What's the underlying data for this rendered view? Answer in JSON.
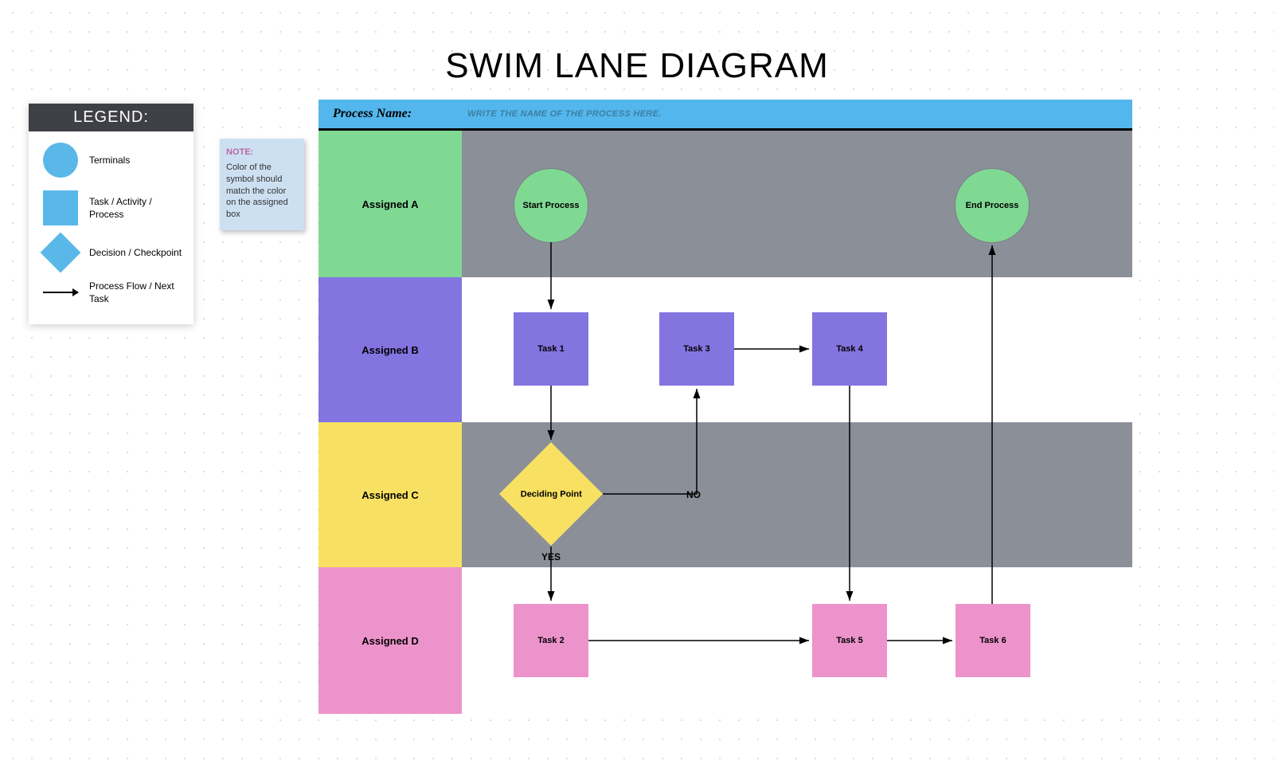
{
  "title": "SWIM LANE DIAGRAM",
  "legend": {
    "header": "LEGEND:",
    "items": [
      {
        "label": "Terminals"
      },
      {
        "label": "Task / Activity / Process"
      },
      {
        "label": "Decision / Checkpoint"
      },
      {
        "label": "Process Flow / Next Task"
      }
    ]
  },
  "note": {
    "title": "NOTE:",
    "text": "Color of the symbol should match the color on the assigned box"
  },
  "process_bar": {
    "label": "Process Name:",
    "placeholder": "WRITE THE NAME OF THE PROCESS HERE."
  },
  "lanes": [
    {
      "label": "Assigned A"
    },
    {
      "label": "Assigned B"
    },
    {
      "label": "Assigned C"
    },
    {
      "label": "Assigned D"
    }
  ],
  "nodes": {
    "start": "Start Process",
    "end": "End Process",
    "task1": "Task 1",
    "task2": "Task 2",
    "task3": "Task 3",
    "task4": "Task 4",
    "task5": "Task 5",
    "task6": "Task 6",
    "decision": "Deciding Point",
    "no": "NO",
    "yes": "YES"
  }
}
